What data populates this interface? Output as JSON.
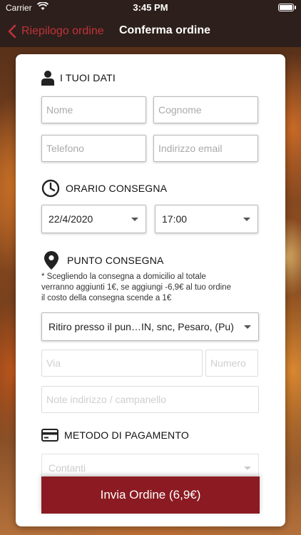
{
  "status_bar": {
    "carrier": "Carrier",
    "time": "3:45 PM",
    "battery_level": 1.0
  },
  "nav": {
    "back_label": "Riepilogo ordine",
    "title": "Conferma ordine"
  },
  "colors": {
    "accent": "#c0333b",
    "button": "#8b1a22",
    "nav_bg": "#2d1f1b"
  },
  "personal": {
    "header": "I TUOI DATI",
    "icon": "user-icon",
    "first_name_placeholder": "Nome",
    "last_name_placeholder": "Cognome",
    "phone_placeholder": "Telefono",
    "email_placeholder": "Indirizzo email"
  },
  "delivery_time": {
    "header": "ORARIO CONSEGNA",
    "icon": "clock-icon",
    "date": "22/4/2020",
    "time": "17:00"
  },
  "delivery_point": {
    "header": "PUNTO CONSEGNA",
    "icon": "map-pin-icon",
    "note_line1": "* Scegliendo la consegna a domicilio al totale",
    "note_line2": "verranno aggiunti 1€, se aggiungi -6,9€ al tuo ordine",
    "note_line3": "il costo della consegna scende a 1€",
    "selected": "Ritiro presso il pun…IN, snc,  Pesaro, (Pu)",
    "street_placeholder": "Via",
    "number_placeholder": "Numero",
    "notes_placeholder": "Note indirizzo / campanello"
  },
  "payment": {
    "header": "METODO DI PAGAMENTO",
    "icon": "credit-card-icon",
    "selected": "Contanti"
  },
  "submit_label": "Invia Ordine (6,9€)"
}
